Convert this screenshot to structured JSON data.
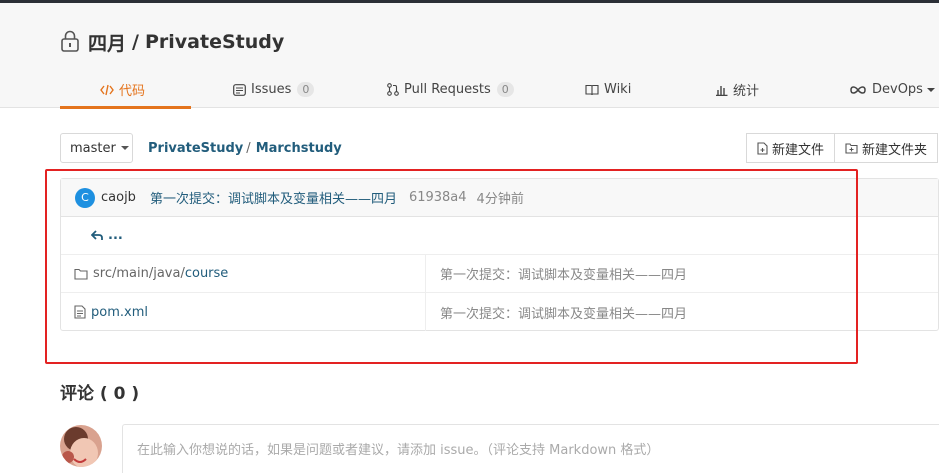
{
  "repo": {
    "owner": "四月",
    "separator": "/",
    "name": "PrivateStudy"
  },
  "tabs": [
    {
      "label": "代码",
      "icon": "code-icon",
      "active": true
    },
    {
      "label": "Issues",
      "count": "0",
      "icon": "issues-icon"
    },
    {
      "label": "Pull Requests",
      "count": "0",
      "icon": "pull-request-icon"
    },
    {
      "label": "Wiki",
      "icon": "wiki-icon"
    },
    {
      "label": "统计",
      "icon": "stats-icon"
    },
    {
      "label": "DevOps",
      "icon": "devops-icon"
    }
  ],
  "branch": {
    "value": "master"
  },
  "breadcrumb": {
    "root": "PrivateStudy",
    "sep": "/",
    "current": "Marchstudy"
  },
  "toolbar": {
    "new_file": "新建文件",
    "new_folder": "新建文件夹"
  },
  "commit": {
    "avatar_letter": "C",
    "author": "caojb",
    "message": "第一次提交：调试脚本及变量相关——四月",
    "sha": "61938a4",
    "time": "4分钟前"
  },
  "back_row": {
    "label": "..."
  },
  "files": [
    {
      "type": "folder",
      "path_prefix": "src/main/java/",
      "name": "course",
      "message": "第一次提交：调试脚本及变量相关——四月"
    },
    {
      "type": "file",
      "name": "pom.xml",
      "message": "第一次提交：调试脚本及变量相关——四月"
    }
  ],
  "comments": {
    "title": "评论 ( 0 )",
    "placeholder": "在此输入你想说的话，如果是问题或者建议，请添加 issue。（评论支持 Markdown 格式）"
  },
  "colors": {
    "accent": "#e4741d",
    "link": "#225d7c",
    "highlight": "#e32222"
  }
}
